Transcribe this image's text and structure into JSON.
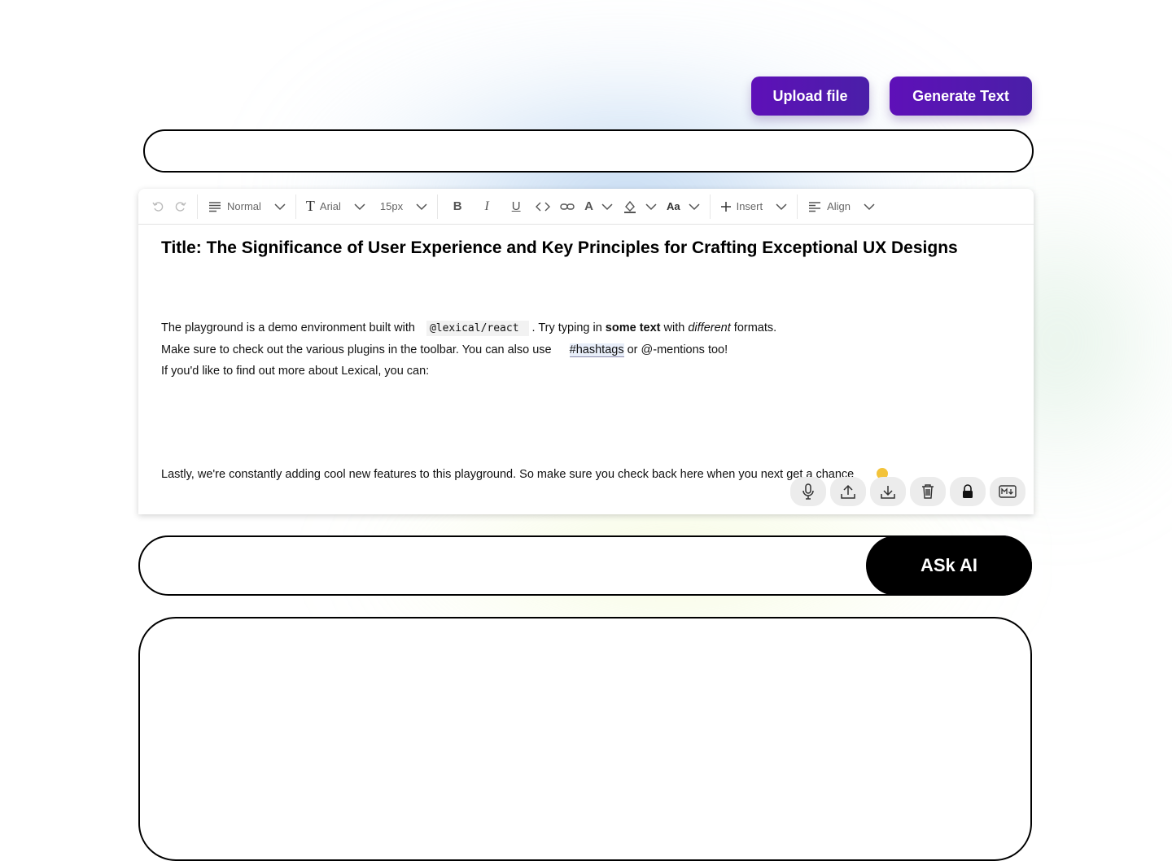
{
  "buttons": {
    "upload": "Upload file",
    "generate": "Generate Text",
    "ask": "ASk AI"
  },
  "toolbar": {
    "block_type": "Normal",
    "font_family": "Arial",
    "font_size": "15px",
    "case": "Aa",
    "insert": "Insert",
    "align": "Align"
  },
  "document": {
    "title": "Title: The Significance of User Experience and Key Principles for Crafting Exceptional UX Designs",
    "p1_a": "The playground is a demo environment built with",
    "p1_code": "@lexical/react",
    "p1_b": ". Try typing in",
    "p1_bold": "some text",
    "p1_c": "with",
    "p1_italic": "different",
    "p1_d": "formats.",
    "p2_a": "Make sure to check out the various plugins in the toolbar. You can also use",
    "p2_hashtag": "#hashtags",
    "p2_b": "or @-mentions too!",
    "p3": "If you'd like to find out more about Lexical, you can:",
    "p4": "Lastly, we're constantly adding cool new features to this playground. So make sure you check back here when you next get a chance"
  },
  "icons": [
    "undo-icon",
    "redo-icon",
    "paragraph-icon",
    "font-icon",
    "bold-icon",
    "italic-icon",
    "underline-icon",
    "code-icon",
    "link-icon",
    "text-color-icon",
    "highlight-icon",
    "plus-icon",
    "align-left-icon",
    "microphone-icon",
    "upload-icon",
    "download-icon",
    "trash-icon",
    "lock-icon",
    "markdown-icon"
  ]
}
